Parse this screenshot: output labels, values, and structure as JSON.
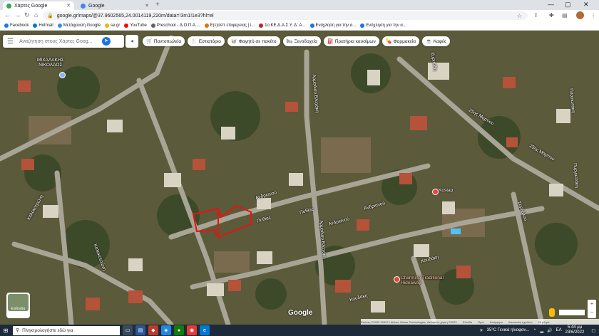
{
  "browser": {
    "tabs": [
      {
        "title": "Χάρτες Google",
        "active": true,
        "favicon_color": "#34a853"
      },
      {
        "title": "Google",
        "active": false,
        "favicon_color": "#4285f4"
      }
    ],
    "new_tab": "+",
    "url": "google.gr/maps/@37.9602565,24.0014119,220m/data=!3m1!1e3?hl=el",
    "bookmarks": [
      {
        "label": "Facebook",
        "icon": "facebook-icon",
        "color": "#1877f2"
      },
      {
        "label": "Hotmail",
        "icon": "outlook-icon",
        "color": "#0078d4"
      },
      {
        "label": "Μετάφραση Google",
        "icon": "translate-icon",
        "color": "#4285f4"
      },
      {
        "label": "se.gr",
        "icon": "se-icon",
        "color": "#f4b400"
      },
      {
        "label": "YouTube",
        "icon": "youtube-icon",
        "color": "#ff0000"
      },
      {
        "label": "Preschool - Δ.Ο.Π.Α....",
        "icon": "page-icon",
        "color": "#5f6368"
      },
      {
        "label": "Ε(ε)σεπ επιφερειας | i...",
        "icon": "page-icon",
        "color": "#e37400"
      },
      {
        "label": "1ο ΚΕ.Δ.Α.Σ.Υ. Δ΄ Α...",
        "icon": "page-icon",
        "color": "#c5221f"
      },
      {
        "label": "Ενόχληση για την α...",
        "icon": "page-icon",
        "color": "#1a73e8"
      },
      {
        "label": "Ενόχληση για την α...",
        "icon": "page-icon",
        "color": "#1a73e8"
      }
    ]
  },
  "map": {
    "search_placeholder": "Αναζήτηση στους Χάρτες Goog...",
    "chips": [
      {
        "label": "Παντοπωλεία",
        "icon": "cart-icon",
        "glyph": "🛒"
      },
      {
        "label": "Εστιατόριο",
        "icon": "restaurant-icon",
        "glyph": "🍴"
      },
      {
        "label": "Φαγητό σε πακέτο",
        "icon": "takeout-icon",
        "glyph": "🥡"
      },
      {
        "label": "Ξενοδοχεία",
        "icon": "hotel-icon",
        "glyph": "🛏"
      },
      {
        "label": "Πρατήρια καυσίμων",
        "icon": "fuel-icon",
        "glyph": "⛽"
      },
      {
        "label": "Φαρμακεία",
        "icon": "pharmacy-icon",
        "glyph": "💊"
      },
      {
        "label": "Καφές",
        "icon": "coffee-icon",
        "glyph": "☕"
      }
    ],
    "place_labels": [
      "ΜΙΧΑΛΑΚΗΣ\nΝΙΚΟΛΑΟΣ",
      "Ανδριανού",
      "Ανδριανού",
      "Ανδριανού",
      "Πυθίας",
      "Πυθίας",
      "Αρμόδιου Βλαχάκη",
      "Αρμόδιου Βλαχάκη",
      "Κολοκοτρώνη",
      "Κολοκοτρώνη",
      "Κουδάκη",
      "Κουδάκη",
      "25ης Μαρτίου",
      "25ης Μαρτίου",
      "Πυργιωτάκη",
      "Πυργιωτάκη",
      "Σαρλάλου",
      "Ευριπίδη",
      "Charming Traditional\nHideaway",
      "Kostap"
    ],
    "layers_label": "Επίπεδα",
    "google_logo": "Google",
    "attribution": [
      "Εικόνες ©2022 CNES / Airbus, Maxar Technologies, Δεδομένα χάρτη ©2022",
      "Ελλάδα",
      "Όροι",
      "Απόρρητο",
      "Αποστολή σχολίων",
      "20 μέτρα"
    ]
  },
  "taskbar": {
    "search_placeholder": "Πληκτρολογήστε εδώ για",
    "weather": "35°C Γενικά ηλιοφαν...",
    "time": "5:44 μμ",
    "date": "23/6/2022",
    "lang": "ΕΛ"
  }
}
